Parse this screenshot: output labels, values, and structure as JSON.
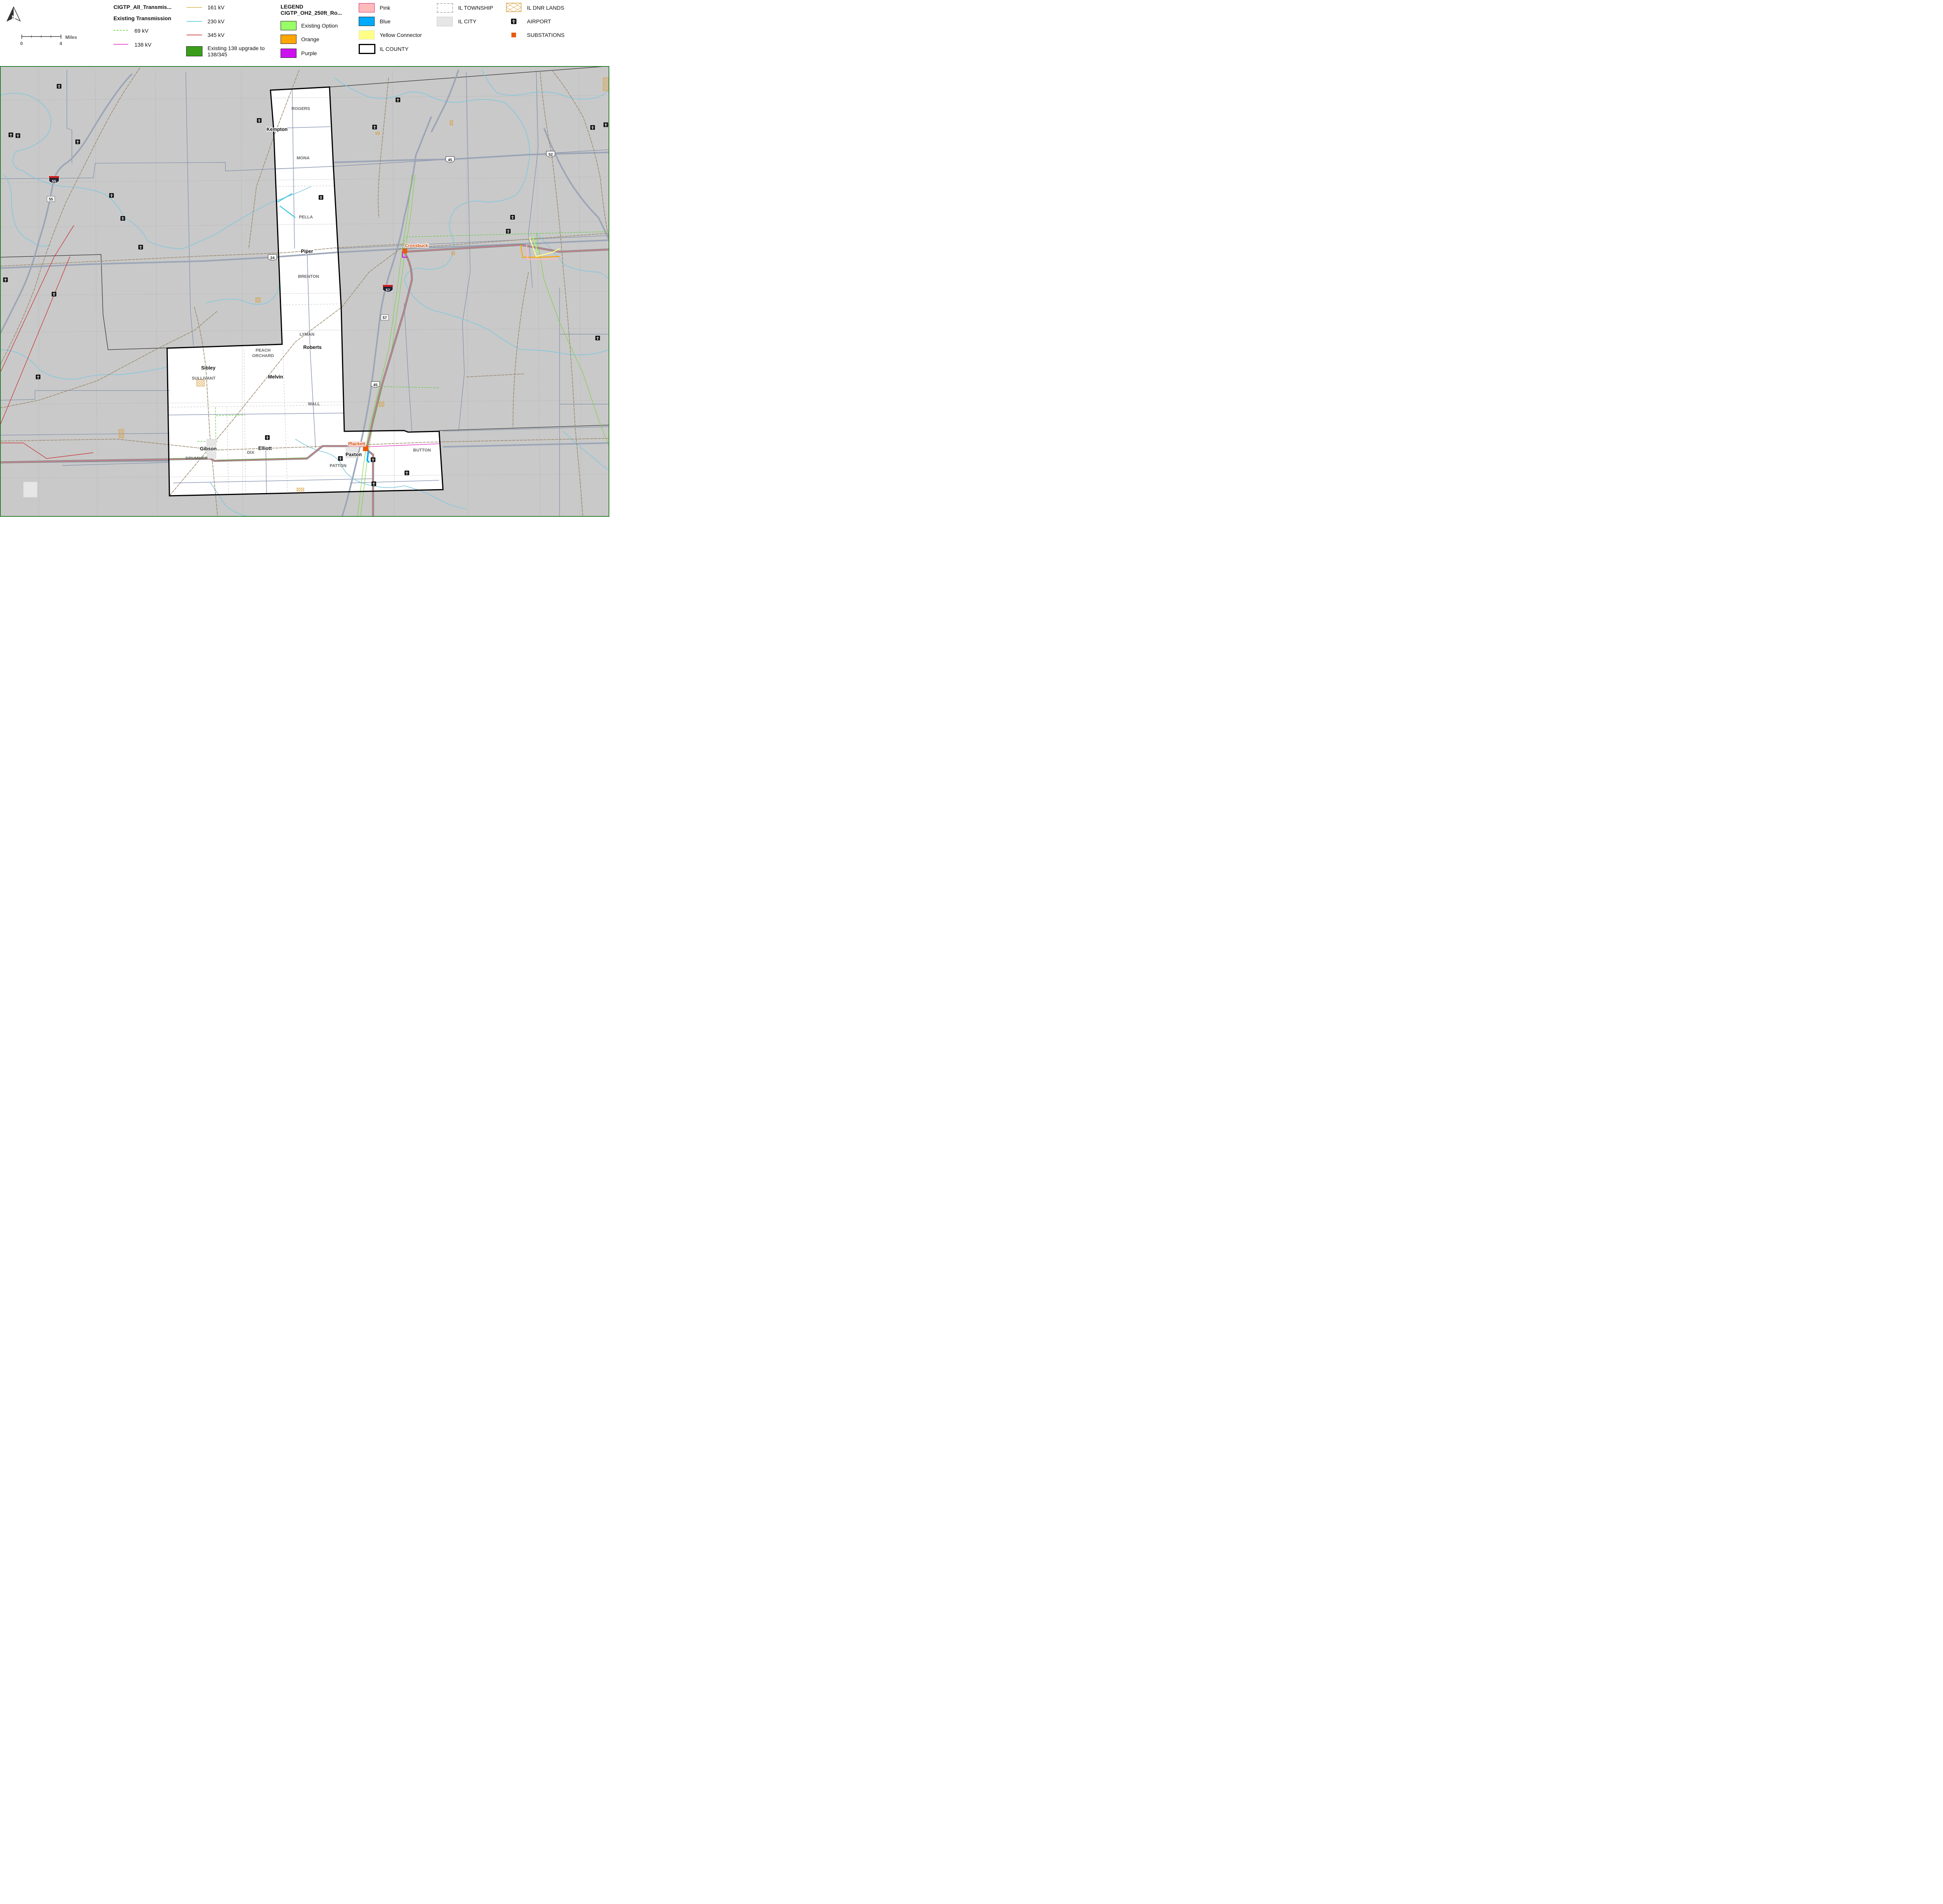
{
  "legend": {
    "layer_title": "CIGTP_All_Transmis...",
    "subheading": "Existing Transmission",
    "legend_word": "LEGEND",
    "route_layer": "CIGTP_OH2_250ft_Ro...",
    "items": {
      "kv69": "69 kV",
      "kv138": "138 kV",
      "kv161": "161 kV",
      "kv230": "230 kV",
      "kv345": "345 kV",
      "upgrade": "Existing 138 upgrade to 138/345",
      "existing_option": "Existing Option",
      "orange": "Orange",
      "purple": "Purple",
      "pink": "Pink",
      "blue": "Blue",
      "yellow": "Yellow Connector",
      "il_county": "IL COUNTY",
      "il_township": "IL TOWNSHIP",
      "il_city": "IL CITY",
      "il_dnr": "IL DNR LANDS",
      "airport": "AIRPORT",
      "substations": "SUBSTATIONS"
    },
    "colors": {
      "kv69": "#55cc33",
      "kv138": "#dd22bb",
      "kv161": "#d8b050",
      "kv230": "#40c8e0",
      "kv345": "#cc2222",
      "upgrade": "#3a9e1a",
      "existing_option": "#99ff66",
      "orange": "#ffa500",
      "purple": "#cc11ee",
      "pink": "#ffbbbb",
      "blue": "#00aaff",
      "yellow": "#ffff88",
      "substation": "#e85a10"
    }
  },
  "scale": {
    "unit": "Miles",
    "start": "0",
    "end": "4"
  },
  "north_arrow": {
    "letter": "N"
  },
  "map": {
    "places": {
      "kempton": "Kempton",
      "piper": "Piper",
      "roberts": "Roberts",
      "melvin": "Melvin",
      "sibley": "Sibley",
      "gibson": "Gibson",
      "elliott": "Elliott",
      "paxton": "Paxton",
      "crossbuck": "Crossbuck",
      "plackett": "Plackett"
    },
    "townships": {
      "rogers": "ROGERS",
      "mona": "MONA",
      "pella": "PELLA",
      "brenton": "BRENTON",
      "lyman": "LYMAN",
      "peach1": "PEACH",
      "peach2": "ORCHARD",
      "sullivant": "SULLIVANT",
      "wall": "WALL",
      "dix": "DIX",
      "drummer": "DRUMMER",
      "patton": "PATTON",
      "button": "BUTTON"
    },
    "shields": {
      "i55": "55",
      "us55": "55",
      "us24": "24",
      "i57": "57",
      "us57": "57",
      "us45a": "45",
      "us45b": "45",
      "us52": "52"
    }
  }
}
